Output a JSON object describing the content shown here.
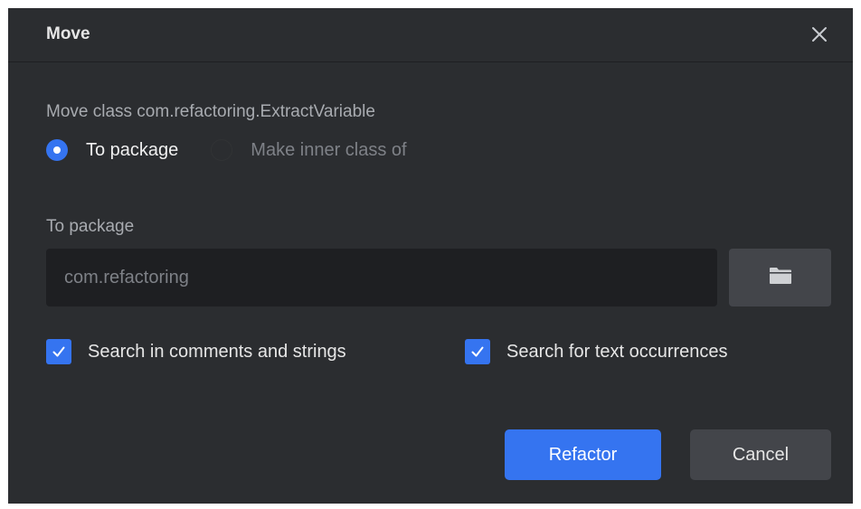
{
  "dialog": {
    "title": "Move",
    "close_icon": "close-icon"
  },
  "description": "Move class com.refactoring.ExtractVariable",
  "move_target": {
    "options": [
      {
        "label": "To package",
        "selected": true
      },
      {
        "label": "Make inner class of",
        "selected": false
      }
    ]
  },
  "package_field": {
    "label": "To package",
    "placeholder": "com.refactoring",
    "browse_icon": "folder-icon"
  },
  "options": {
    "search_comments": {
      "label": "Search in comments and strings",
      "checked": true
    },
    "search_text": {
      "label": "Search for text occurrences",
      "checked": true
    }
  },
  "buttons": {
    "refactor": "Refactor",
    "cancel": "Cancel"
  },
  "colors": {
    "background": "#2b2d30",
    "accent": "#3574f0",
    "input_background": "#1e1f22",
    "secondary_button": "#43454a"
  }
}
